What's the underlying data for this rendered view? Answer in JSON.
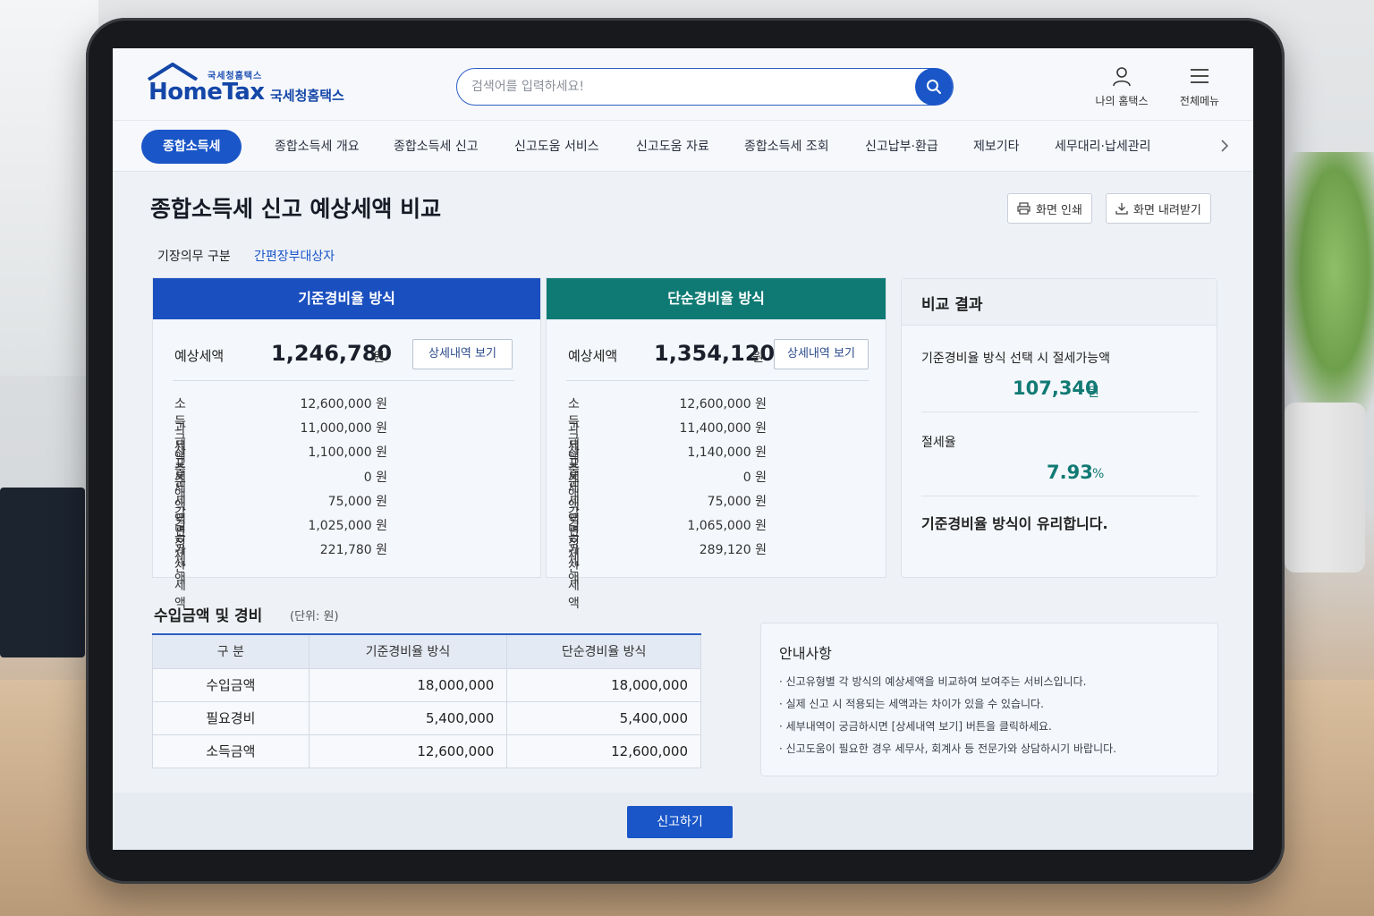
{
  "header": {
    "logo_sup": "국세청홈택스",
    "logo_main": "HomeTax",
    "logo_kr": "국세청홈택스",
    "search_placeholder": "검색어를 입력하세요!",
    "my_hometax": "나의 홈택스",
    "all_menu": "전체메뉴"
  },
  "nav": {
    "items": [
      "종합소득세",
      "종합소득세 개요",
      "종합소득세 신고",
      "신고도움 서비스",
      "신고도움 자료",
      "종합소득세 조회",
      "신고납부·환급",
      "제보기타",
      "세무대리·납세관리"
    ],
    "active": "종합소득세"
  },
  "page": {
    "title": "종합소득세 신고 예상세액 비교",
    "print_label": "화면 인쇄",
    "download_label": "화면 내려받기",
    "duty_label": "기장의무 구분",
    "duty_value": "간편장부대상자"
  },
  "methods": [
    {
      "title": "기준경비율 방식",
      "tax_label": "예상세액",
      "tax_value": "1,246,780",
      "unit": "원",
      "detail_label": "상세내역 보기",
      "rows": [
        {
          "label": "소득금액",
          "value": "12,600,000 원"
        },
        {
          "label": "과세표준",
          "value": "11,000,000 원"
        },
        {
          "label": "산출세액",
          "value": "1,100,000 원"
        },
        {
          "label": "세액감면",
          "value": "0 원"
        },
        {
          "label": "세액공제",
          "value": "75,000 원"
        },
        {
          "label": "결정세액",
          "value": "1,025,000 원"
        },
        {
          "label": "가산세액",
          "value": "221,780 원"
        }
      ]
    },
    {
      "title": "단순경비율 방식",
      "tax_label": "예상세액",
      "tax_value": "1,354,120",
      "unit": "원",
      "detail_label": "상세내역 보기",
      "rows": [
        {
          "label": "소득금액",
          "value": "12,600,000 원"
        },
        {
          "label": "과세표준",
          "value": "11,400,000 원"
        },
        {
          "label": "산출세액",
          "value": "1,140,000 원"
        },
        {
          "label": "세액감면",
          "value": "0 원"
        },
        {
          "label": "세액공제",
          "value": "75,000 원"
        },
        {
          "label": "결정세액",
          "value": "1,065,000 원"
        },
        {
          "label": "가산세액",
          "value": "289,120 원"
        }
      ]
    }
  ],
  "result": {
    "title": "비교 결과",
    "saving_label": "기준경비율 방식 선택 시 절세가능액",
    "saving_value": "107,340",
    "saving_unit": "원",
    "rate_label": "절세율",
    "rate_value": "7.93",
    "rate_unit": "%",
    "conclusion": "기준경비율 방식이 유리합니다."
  },
  "income": {
    "title": "수입금액 및 경비",
    "unit_note": "(단위: 원)",
    "headers": [
      "구 분",
      "기준경비율 방식",
      "단순경비율 방식"
    ],
    "rows": [
      [
        "수입금액",
        "18,000,000",
        "18,000,000"
      ],
      [
        "필요경비",
        "5,400,000",
        "5,400,000"
      ],
      [
        "소득금액",
        "12,600,000",
        "12,600,000"
      ]
    ]
  },
  "notice": {
    "title": "안내사항",
    "items": [
      "· 신고유형별 각 방식의 예상세액을 비교하여 보여주는 서비스입니다.",
      "· 실제 신고 시 적용되는 세액과는 차이가 있을 수 있습니다.",
      "· 세부내역이 궁금하시면 [상세내역 보기] 버튼을 클릭하세요.",
      "· 신고도움이 필요한 경우 세무사, 회계사 등 전문가와 상담하시기 바랍니다."
    ]
  },
  "footer": {
    "submit_label": "신고하기"
  },
  "colors": {
    "primary": "#1a56c8",
    "teal": "#0f7a74",
    "card_blue": "#1a4fbf"
  }
}
